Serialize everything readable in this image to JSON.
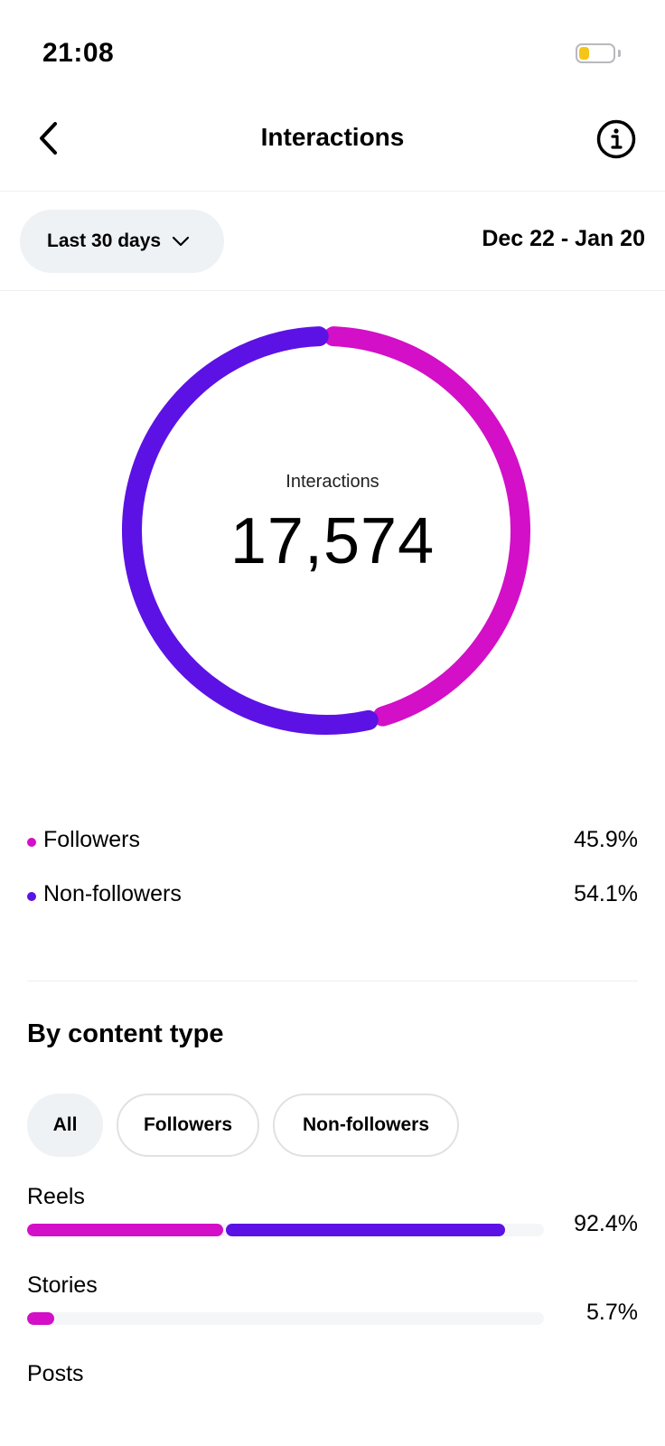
{
  "status": {
    "time": "21:08",
    "battery_color": "#f5c518"
  },
  "nav": {
    "title": "Interactions",
    "back_icon": "chevron-left-icon",
    "info_icon": "info-icon"
  },
  "filter": {
    "range_label": "Last 30 days",
    "date_range": "Dec 22 - Jan 20"
  },
  "summary": {
    "caption": "Interactions",
    "total": "17,574",
    "followers": {
      "label": "Followers",
      "value": "45.9%",
      "fraction": 0.459,
      "color": "#d30fc7"
    },
    "non_followers": {
      "label": "Non-followers",
      "value": "54.1%",
      "fraction": 0.541,
      "color": "#5c12e4"
    }
  },
  "content_type": {
    "title": "By content type",
    "tabs": [
      "All",
      "Followers",
      "Non-followers"
    ],
    "active_tab": "All",
    "items": [
      {
        "label": "Reels",
        "value": "92.4%",
        "total_fraction": 0.924,
        "followers_fraction": 0.38
      },
      {
        "label": "Stories",
        "value": "5.7%",
        "total_fraction": 0.057,
        "followers_fraction": 0.052
      },
      {
        "label": "Posts"
      }
    ]
  }
}
